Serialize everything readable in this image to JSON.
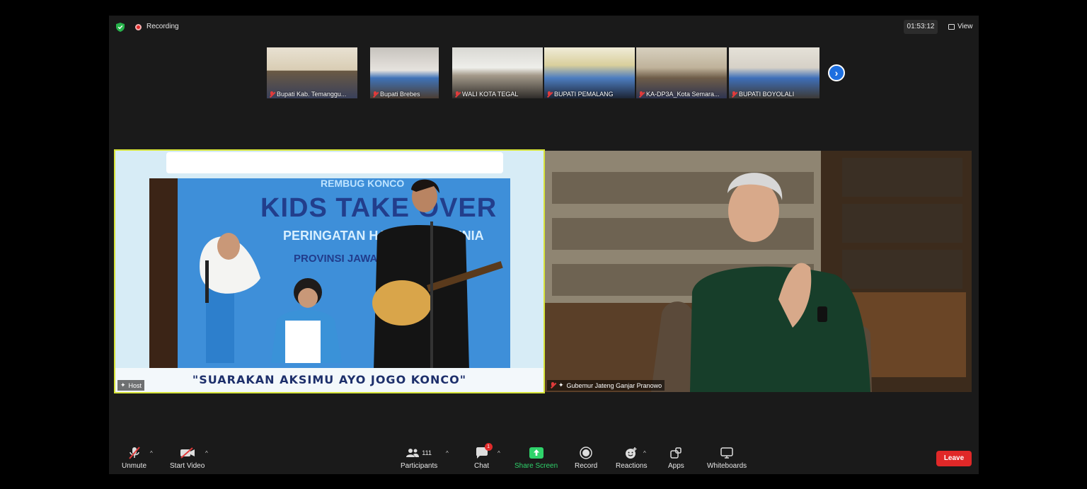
{
  "topbar": {
    "recording_label": "Recording",
    "timer": "01:53:12",
    "view_label": "View"
  },
  "thumbnails": [
    {
      "name": "Bupati Kab. Temanggu..."
    },
    {
      "name": "Bupati Brebes"
    },
    {
      "name": "WALI KOTA TEGAL"
    },
    {
      "name": "BUPATI PEMALANG"
    },
    {
      "name": "KA-DP3A_Kota Semara..."
    },
    {
      "name": "BUPATI BOYOLALI"
    }
  ],
  "main_left": {
    "label": "Host",
    "banner_kicker": "REMBUG KONCO",
    "banner_title": "KIDS TAKE OVER",
    "banner_line2": "PERINGATAN HARI ANAK DUNIA",
    "banner_line3": "PROVINSI JAWA",
    "tagline": "\"SUARAKAN AKSIMU AYO JOGO KONCO\""
  },
  "main_right": {
    "label": "Gubemur Jateng Ganjar Pranowo"
  },
  "toolbar": {
    "unmute": "Unmute",
    "start_video": "Start Video",
    "participants": "Participants",
    "participants_count": "111",
    "chat": "Chat",
    "chat_badge": "1",
    "share_screen": "Share Screen",
    "record": "Record",
    "reactions": "Reactions",
    "apps": "Apps",
    "whiteboards": "Whiteboards",
    "leave": "Leave"
  },
  "colors": {
    "accent_green": "#2fd36b",
    "leave_red": "#e02828",
    "active_speaker": "#d6e33a",
    "nav_blue": "#1d6fe0"
  }
}
